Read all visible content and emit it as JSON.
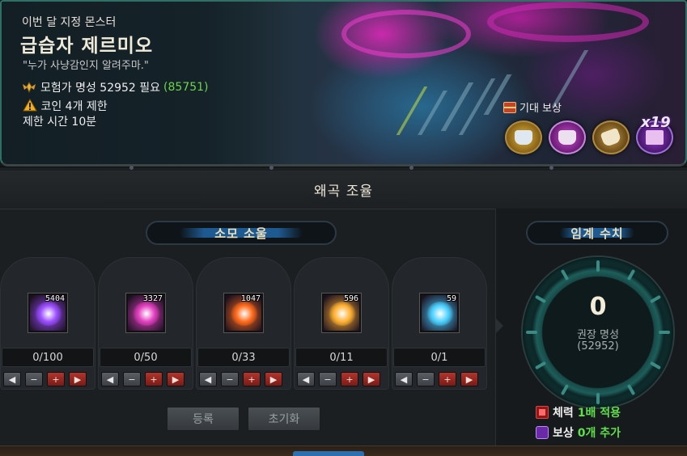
{
  "banner": {
    "subtitle": "이번 달 지정 몬스터",
    "boss_name": "급습자 제르미오",
    "quote": "\"누가 사냥감인지 알려주마.\"",
    "fame_text": "모험가 명성 52952 필요",
    "fame_user": "(85751)",
    "coin_limit": "코인 4개 제한",
    "time_limit": "제한 시간 10분",
    "reward_label": "기대 보상",
    "reward_multiplier": "x19",
    "reward_icons": [
      "silver-armor-icon",
      "purple-armor-icon",
      "gold-weapon-icon",
      "epic-chest-icon"
    ]
  },
  "main": {
    "title": "왜곡 조율",
    "soul_section_title": "소모 소울",
    "slots": [
      {
        "stock": "5404",
        "count": "0/100",
        "color": "#9b4dff"
      },
      {
        "stock": "3327",
        "count": "0/50",
        "color": "#e23fbf"
      },
      {
        "stock": "1047",
        "count": "0/33",
        "color": "#ff6a1a"
      },
      {
        "stock": "596",
        "count": "0/11",
        "color": "#ffb030"
      },
      {
        "stock": "59",
        "count": "0/1",
        "color": "#4ad0ff"
      }
    ],
    "btn_labels": {
      "first": "◀",
      "minus": "−",
      "plus": "+",
      "last": "▶"
    },
    "register_label": "등록",
    "reset_label": "초기화"
  },
  "critical": {
    "title": "임계 수치",
    "value": "0",
    "label": "권장 명성",
    "fame": "(52952)",
    "hp_label": "체력",
    "hp_value": "1배 적용",
    "reward_label": "보상",
    "reward_value": "0개 추가"
  },
  "colors": {
    "accent_green": "#6cd64a",
    "title_gold": "#eddfb8",
    "button_red": "#b0352d"
  }
}
